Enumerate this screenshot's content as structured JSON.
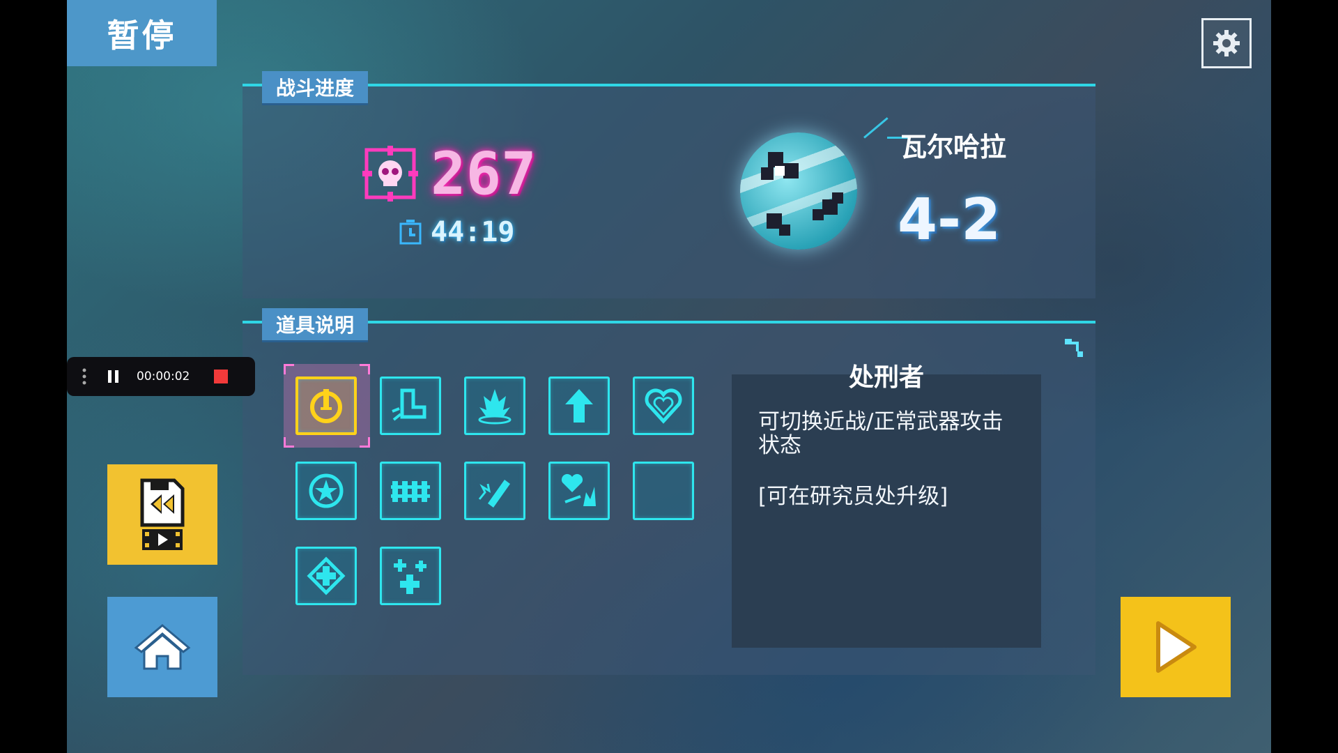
{
  "header": {
    "pause_title": "暂停"
  },
  "progress": {
    "tab_label": "战斗进度",
    "kills": "267",
    "time": "44:19",
    "planet_name": "瓦尔哈拉",
    "stage": "4-2"
  },
  "items": {
    "tab_label": "道具说明",
    "list": [
      {
        "icon": "power-icon",
        "selected": true
      },
      {
        "icon": "boot-icon"
      },
      {
        "icon": "fire-icon"
      },
      {
        "icon": "arrow-up-icon"
      },
      {
        "icon": "heart-icon"
      },
      {
        "icon": "star-circle-icon"
      },
      {
        "icon": "fence-icon"
      },
      {
        "icon": "flame-bullet-icon"
      },
      {
        "icon": "heart-explode-icon"
      },
      {
        "icon": "crescent-icon"
      },
      {
        "icon": "plus-diamond-icon"
      },
      {
        "icon": "plus-multi-icon"
      }
    ],
    "selected_name": "处刑者",
    "selected_desc": "可切换近战/正常武器攻击状态",
    "selected_note": "[可在研究员处升级]"
  },
  "recorder": {
    "time": "00:00:02"
  },
  "colors": {
    "accent": "#2ee6ee",
    "selected": "#ffd21a",
    "kill": "#f7b7e4"
  }
}
